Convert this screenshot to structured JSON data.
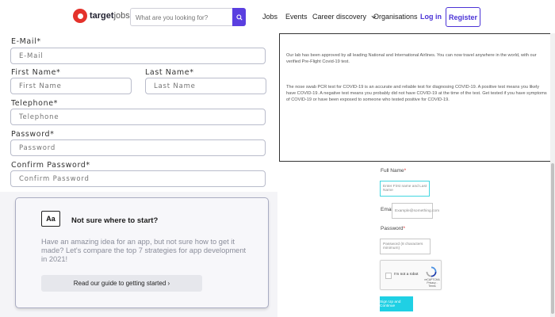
{
  "header": {
    "logo_main": "target",
    "logo_sub": "jobs",
    "search_placeholder": "What are you looking for?",
    "nav": {
      "jobs": "Jobs",
      "events": "Events",
      "career": "Career discovery",
      "orgs": "Organisations",
      "login": "Log in",
      "register": "Register"
    }
  },
  "signup": {
    "email_label": "E-Mail*",
    "email_placeholder": "E-Mail",
    "first_label": "First Name*",
    "first_placeholder": "First Name",
    "last_label": "Last Name*",
    "last_placeholder": "Last Name",
    "phone_label": "Telephone*",
    "phone_placeholder": "Telephone",
    "password_label": "Password*",
    "password_placeholder": "Password",
    "confirm_label": "Confirm Password*",
    "confirm_placeholder": "Confirm Password"
  },
  "card": {
    "icon_text": "Aa",
    "title": "Not sure where to start?",
    "description": "Have an amazing idea for an app, but not sure how to get it made? Let's compare the top 7 strategies for app development in 2021!",
    "button": "Read our guide to getting started ›"
  },
  "info": {
    "p1": "Our lab has been approved by all leading National and International Airlines. You can now travel anywhere in the world, with our verified Pre-Flight Covid-19 test.",
    "p2": "The nose swab PCR test for COVID-19 is an accurate and reliable test for diagnosing COVID-19. A positive test means you likely have COVID-19. A negative test means you probably did not have COVID-19 at the time of the test. Get tested if you have symptoms of COVID-19 or have been exposed to someone who tested positive for COVID-19."
  },
  "order_form": {
    "fullname_label": "Full Name",
    "fullname_placeholder": "Enter First name and Last Name",
    "email_label": "Email",
    "email_placeholder": "Example@something.com",
    "password_label": "Password",
    "password_placeholder": "Password (8 characters minimum)",
    "captcha_text": "I'm not a robot",
    "captcha_brand": "reCAPTCHA",
    "captcha_links": "Privacy - Terms",
    "submit": "Sign Up and Continue"
  },
  "colors": {
    "brand_red": "#e4322b",
    "accent_purple": "#4b33d6",
    "search_button": "#5a3fe0",
    "cyan": "#1fd0e4"
  }
}
